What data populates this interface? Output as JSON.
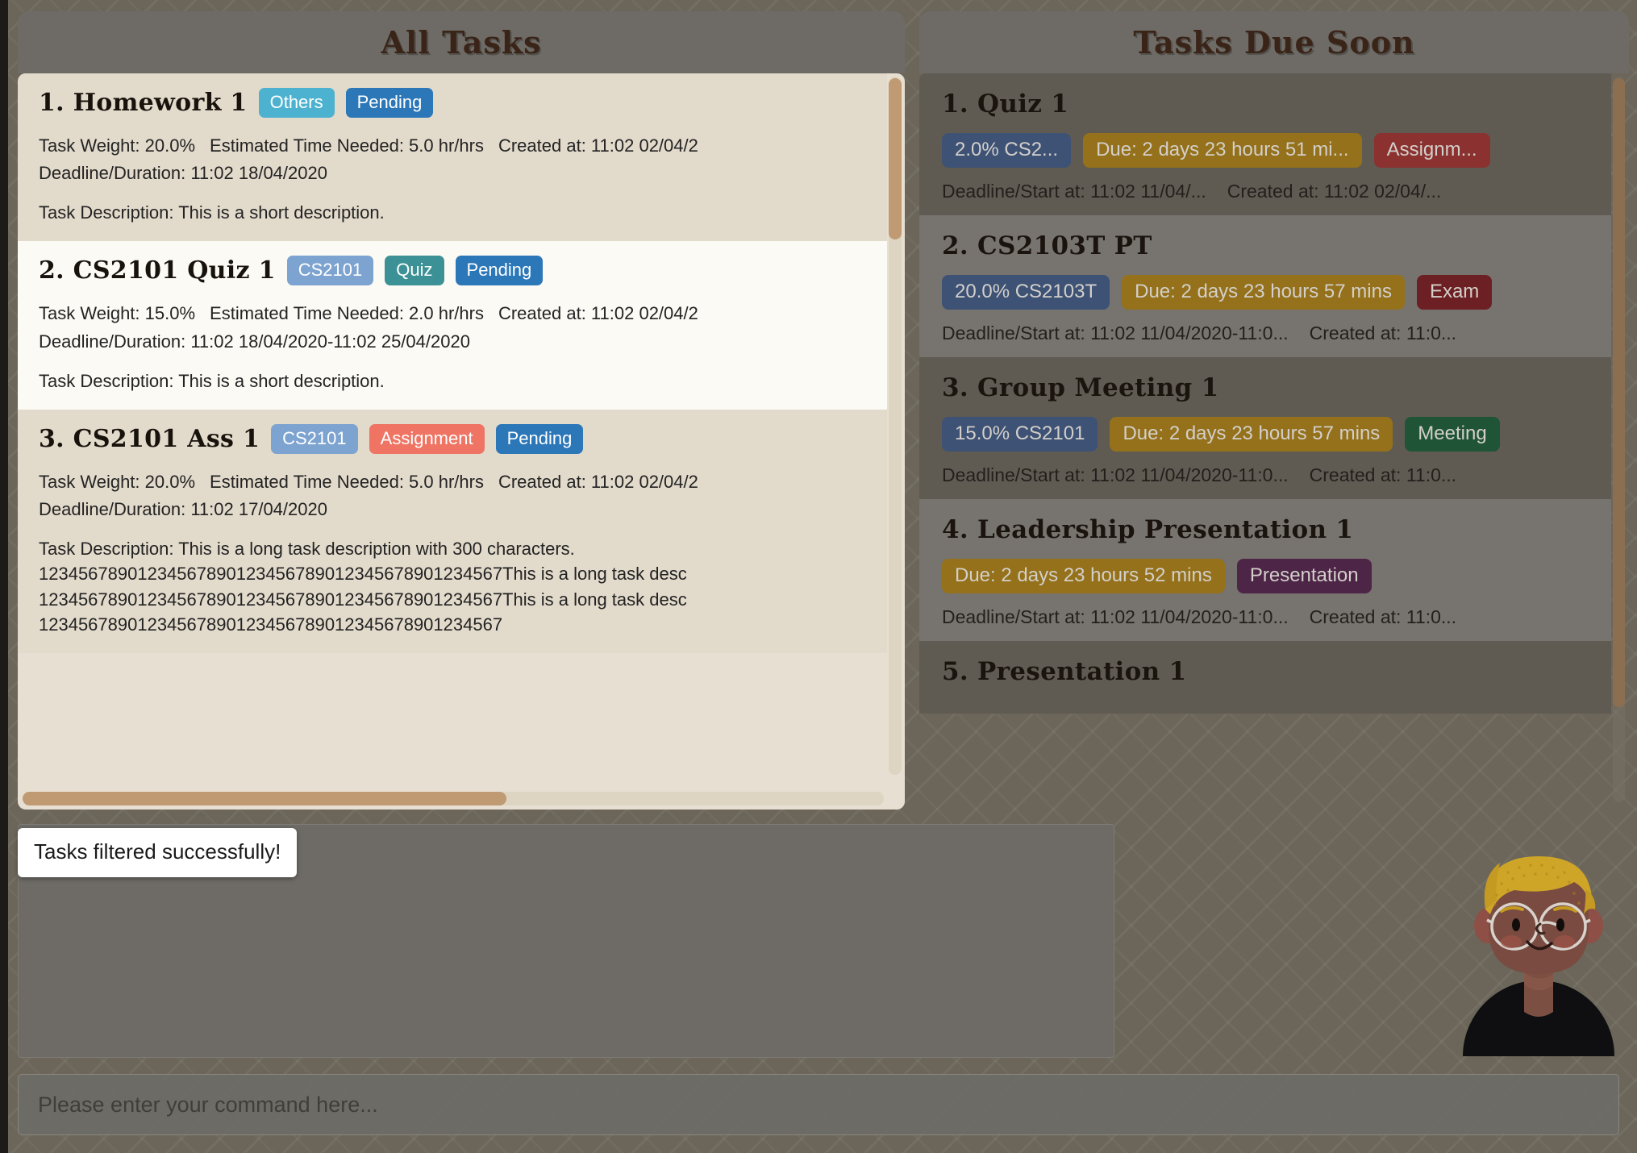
{
  "panels": {
    "left": {
      "title": "All Tasks"
    },
    "right": {
      "title": "Tasks Due Soon"
    }
  },
  "colors": {
    "chip_module": "#7da3d0",
    "chip_others": "#4cb2cf",
    "chip_pending": "#2b77b8",
    "chip_quiz": "#3b9195",
    "chip_assignment": "#ef7463",
    "chip_weight_dim": "#3d5275",
    "chip_due_dim": "#94711a",
    "chip_assign_dim": "#8b3230",
    "chip_exam_dim": "#6c2023",
    "chip_meeting_dim": "#1f5436",
    "chip_presentation_dim": "#4d2547",
    "scrollbar_thumb": "#bf9a72",
    "panel_header_bg": "#6e6b66",
    "page_bg": "#6b6659"
  },
  "all_tasks": [
    {
      "index": "1.",
      "name": "Homework 1",
      "chips": [
        {
          "label": "Others",
          "color": "#4cb2cf"
        },
        {
          "label": "Pending",
          "color": "#2b77b8"
        }
      ],
      "weight": "Task Weight: 20.0%",
      "estimated": "Estimated Time Needed: 5.0 hr/hrs",
      "created": "Created at: 11:02 02/04/2",
      "deadline": "Deadline/Duration: 11:02 18/04/2020",
      "description": "Task Description: This is a short description."
    },
    {
      "index": "2.",
      "name": "CS2101 Quiz 1",
      "chips": [
        {
          "label": "CS2101",
          "color": "#7da3d0"
        },
        {
          "label": "Quiz",
          "color": "#3b9195"
        },
        {
          "label": "Pending",
          "color": "#2b77b8"
        }
      ],
      "weight": "Task Weight: 15.0%",
      "estimated": "Estimated Time Needed: 2.0 hr/hrs",
      "created": "Created at: 11:02 02/04/2",
      "deadline": "Deadline/Duration: 11:02 18/04/2020-11:02 25/04/2020",
      "description": "Task Description: This is a short description."
    },
    {
      "index": "3.",
      "name": "CS2101 Ass 1",
      "chips": [
        {
          "label": "CS2101",
          "color": "#7da3d0"
        },
        {
          "label": "Assignment",
          "color": "#ef7463"
        },
        {
          "label": "Pending",
          "color": "#2b77b8"
        }
      ],
      "weight": "Task Weight: 20.0%",
      "estimated": "Estimated Time Needed: 5.0 hr/hrs",
      "created": "Created at: 11:02 02/04/2",
      "deadline": "Deadline/Duration: 11:02 17/04/2020",
      "description": "Task Description: This is a long task description with 300 characters.\n12345678901234567890123456789012345678901234567This is a long task desc\n12345678901234567890123456789012345678901234567This is a long task desc\n12345678901234567890123456789012345678901234567"
    }
  ],
  "due_soon": [
    {
      "index": "1.",
      "name": "Quiz 1",
      "chips": [
        {
          "label": "2.0% CS2...",
          "color": "#3d5275"
        },
        {
          "label": "Due: 2 days 23 hours 51 mi...",
          "color": "#94711a"
        },
        {
          "label": "Assignm...",
          "color": "#8b3230"
        }
      ],
      "deadline": "Deadline/Start at: 11:02 11/04/...",
      "created": "Created at: 11:02 02/04/..."
    },
    {
      "index": "2.",
      "name": "CS2103T PT",
      "chips": [
        {
          "label": "20.0% CS2103T",
          "color": "#3d5275"
        },
        {
          "label": "Due: 2 days 23 hours 57 mins",
          "color": "#94711a"
        },
        {
          "label": "Exam",
          "color": "#6c2023"
        }
      ],
      "deadline": "Deadline/Start at: 11:02 11/04/2020-11:0...",
      "created": "Created at: 11:0..."
    },
    {
      "index": "3.",
      "name": "Group Meeting 1",
      "chips": [
        {
          "label": "15.0% CS2101",
          "color": "#3d5275"
        },
        {
          "label": "Due: 2 days 23 hours 57 mins",
          "color": "#94711a"
        },
        {
          "label": "Meeting",
          "color": "#1f5436"
        }
      ],
      "deadline": "Deadline/Start at: 11:02 11/04/2020-11:0...",
      "created": "Created at: 11:0..."
    },
    {
      "index": "4.",
      "name": "Leadership Presentation 1",
      "chips": [
        {
          "label": "Due: 2 days 23 hours 52 mins",
          "color": "#94711a"
        },
        {
          "label": "Presentation",
          "color": "#4d2547"
        }
      ],
      "deadline": "Deadline/Start at: 11:02 11/04/2020-11:0...",
      "created": "Created at: 11:0..."
    },
    {
      "index": "5.",
      "name": "Presentation 1",
      "chips": [],
      "deadline": "",
      "created": ""
    }
  ],
  "toast": {
    "message": "Tasks filtered successfully!"
  },
  "command": {
    "value": "",
    "placeholder": "Please enter your command here..."
  }
}
